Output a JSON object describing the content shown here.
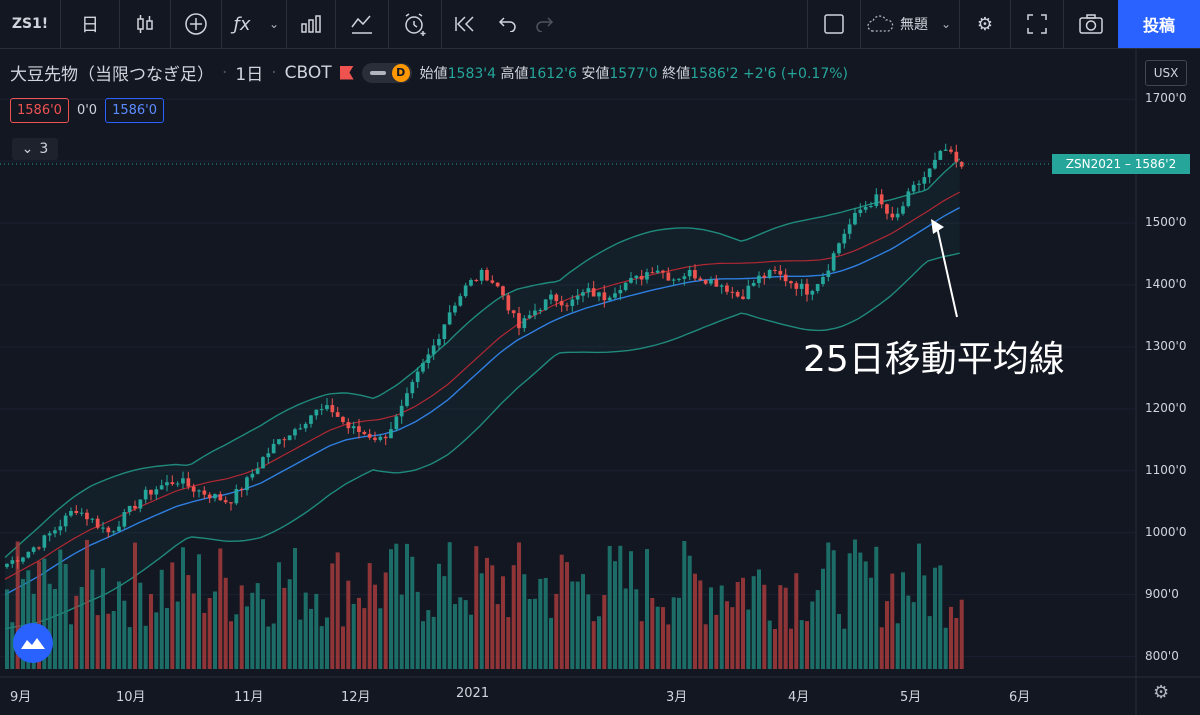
{
  "toolbar": {
    "symbol": "ZS1!",
    "interval_icon": "日",
    "candle-icon": "candle-icon",
    "add_icon": "⊕",
    "fx_icon": "ƒx",
    "save_title": "無題",
    "post_label": "投稿"
  },
  "legend": {
    "title": "大豆先物（当限つなぎ足）",
    "interval": "1日",
    "exchange": "CBOT",
    "d_badge": "D",
    "open_label": "始値",
    "open": "1583'4",
    "high_label": "高値",
    "high": "1612'6",
    "low_label": "安値",
    "low": "1577'0",
    "close_label": "終値",
    "close": "1586'2",
    "change": "+2'6 (+0.17%)"
  },
  "indicator_row": {
    "red_value": "1586'0",
    "mid_value": "0'0",
    "blue_value": "1586'0"
  },
  "collapse": {
    "count": "3"
  },
  "currency": "USX",
  "price_tag": "ZSN2021 – 1586'2",
  "annotation": "25日移動平均線",
  "colors": {
    "background": "#131722",
    "up": "#26a69a",
    "down": "#ef5350",
    "accent": "#2962ff"
  },
  "chart_data": {
    "type": "candlestick",
    "x_tick_labels": [
      "9月",
      "10月",
      "11月",
      "12月",
      "2021",
      "3月",
      "4月",
      "5月",
      "6月"
    ],
    "y_tick_labels": [
      "1700'0",
      "1600'0",
      "1500'0",
      "1400'0",
      "1300'0",
      "1200'0",
      "1100'0",
      "1000'0",
      "900'0",
      "800'0"
    ],
    "ylim": [
      780,
      1710
    ],
    "close_path": [
      950,
      965,
      985,
      1010,
      1040,
      1020,
      1000,
      1030,
      1060,
      1075,
      1085,
      1070,
      1060,
      1050,
      1080,
      1120,
      1150,
      1170,
      1195,
      1200,
      1170,
      1160,
      1150,
      1190,
      1250,
      1300,
      1360,
      1400,
      1420,
      1390,
      1330,
      1360,
      1380,
      1370,
      1390,
      1380,
      1400,
      1410,
      1430,
      1410,
      1420,
      1410,
      1400,
      1380,
      1410,
      1420,
      1405,
      1390,
      1420,
      1480,
      1520,
      1540,
      1500,
      1550,
      1580,
      1620,
      1586
    ],
    "ma25_path": [
      900,
      915,
      930,
      948,
      965,
      980,
      992,
      1005,
      1018,
      1030,
      1042,
      1050,
      1057,
      1062,
      1070,
      1080,
      1095,
      1110,
      1125,
      1140,
      1150,
      1155,
      1158,
      1165,
      1178,
      1195,
      1215,
      1240,
      1265,
      1290,
      1310,
      1325,
      1340,
      1352,
      1362,
      1370,
      1378,
      1385,
      1392,
      1398,
      1404,
      1408,
      1410,
      1410,
      1411,
      1413,
      1414,
      1414,
      1416,
      1422,
      1432,
      1445,
      1458,
      1475,
      1492,
      1510,
      1525
    ]
  }
}
